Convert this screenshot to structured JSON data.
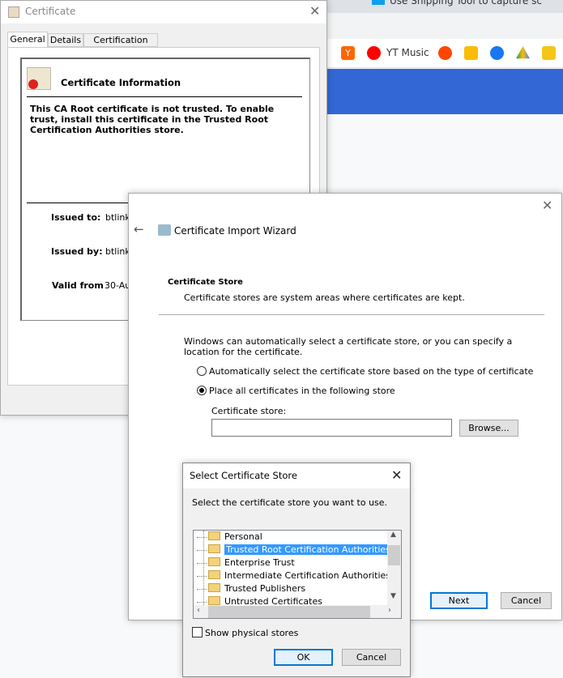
{
  "browser": {
    "tab_title": "Use Snipping Tool to capture sc",
    "bookmarks": [
      {
        "icon": "y-combinator-icon",
        "color": "#ff6600"
      },
      {
        "icon": "yt-music-icon",
        "label": "YT Music",
        "color": "#ff0000"
      },
      {
        "icon": "reddit-icon",
        "color": "#ff4500"
      },
      {
        "icon": "keep-icon",
        "color": "#fbbc04"
      },
      {
        "icon": "facebook-icon",
        "color": "#1877f2"
      },
      {
        "icon": "drive-icon",
        "color": "#34a853"
      },
      {
        "icon": "imdb-icon",
        "color": "#f5c518"
      }
    ],
    "accent": "#3367d6"
  },
  "certificate": {
    "title": "Certificate",
    "tabs": [
      "General",
      "Details",
      "Certification Path"
    ],
    "info_title": "Certificate Information",
    "warning": "This CA Root certificate is not trusted. To enable trust, install this certificate in the Trusted Root Certification Authorities store.",
    "issued_to_label": "Issued to:",
    "issued_to": "btlink",
    "issued_by_label": "Issued by:",
    "issued_by": "btlink",
    "valid_from_label": "Valid from",
    "valid_from": "30-Au"
  },
  "wizard": {
    "title": "Certificate Import Wizard",
    "section": "Certificate Store",
    "section_desc": "Certificate stores are system areas where certificates are kept.",
    "intro": "Windows can automatically select a certificate store, or you can specify a location for the certificate.",
    "option_auto": "Automatically select the certificate store based on the type of certificate",
    "option_place": "Place all certificates in the following store",
    "selected_option": "place",
    "store_label": "Certificate store:",
    "store_value": "",
    "browse": "Browse...",
    "next": "Next",
    "cancel": "Cancel"
  },
  "select_store": {
    "title": "Select Certificate Store",
    "prompt": "Select the certificate store you want to use.",
    "items": [
      "Personal",
      "Trusted Root Certification Authorities",
      "Enterprise Trust",
      "Intermediate Certification Authorities",
      "Trusted Publishers",
      "Untrusted Certificates"
    ],
    "selected": "Trusted Root Certification Authorities",
    "show_physical": "Show physical stores",
    "show_physical_checked": false,
    "ok": "OK",
    "cancel": "Cancel",
    "selection_color": "#3399ff"
  }
}
